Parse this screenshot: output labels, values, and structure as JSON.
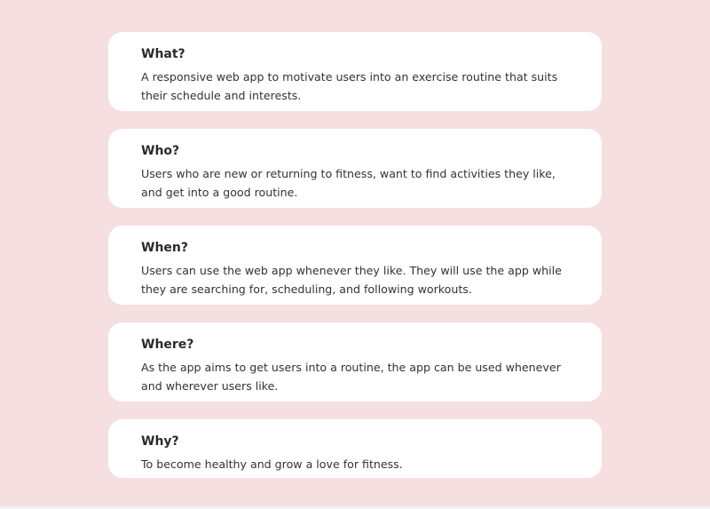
{
  "cards": [
    {
      "title": "What?",
      "text": "A responsive web app to motivate users into an exercise routine that suits their schedule and interests."
    },
    {
      "title": "Who?",
      "text": "Users who are new or returning to fitness, want to find activities they like, and get into a good routine."
    },
    {
      "title": "When?",
      "text": "Users can use the web app whenever they like. They will use the app while they are searching for, scheduling, and following workouts."
    },
    {
      "title": "Where?",
      "text": "As the app aims to get users into a routine, the app can be used whenever and wherever users like."
    },
    {
      "title": "Why?",
      "text": "To become healthy and grow a love for fitness."
    }
  ],
  "colors": {
    "background": "#f6dfe0",
    "card": "#ffffff",
    "heading": "#2b2b2b",
    "body_text": "#333333"
  }
}
